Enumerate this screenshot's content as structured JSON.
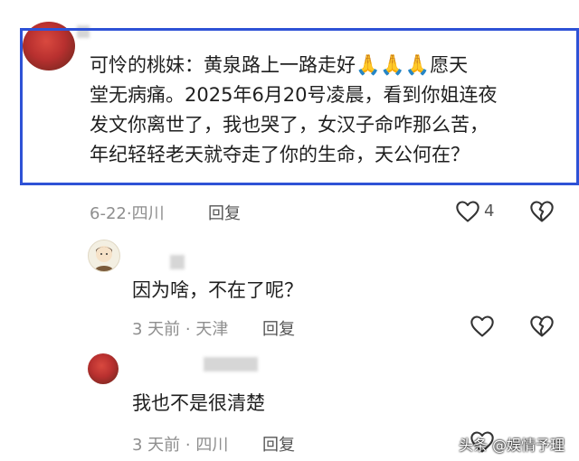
{
  "comments": [
    {
      "author": "可怜的桃妹",
      "separator": "：",
      "text_lines": [
        "黄泉路上一路走好",
        "愿天",
        "堂无病痛。2025年6月20号凌晨，看到你姐连夜",
        "发文你离世了，我也哭了，女汉子命咋那么苦，",
        "年纪轻轻老天就夺走了你的生命，天公何在？"
      ],
      "emoji": "🙏🙏🙏",
      "date": "6-22",
      "location": "四川",
      "reply_label": "回复",
      "like_count": "4"
    },
    {
      "text": "因为啥，不在了呢？",
      "date": "3 天前",
      "location": "天津",
      "reply_label": "回复"
    },
    {
      "text": "我也不是很清楚",
      "date": "3 天前",
      "location": "四川",
      "reply_label": "回复"
    }
  ],
  "watermark": "头条 @娱情予理",
  "colors": {
    "highlight": "#2e52d6",
    "meta": "#8e8e8e"
  }
}
